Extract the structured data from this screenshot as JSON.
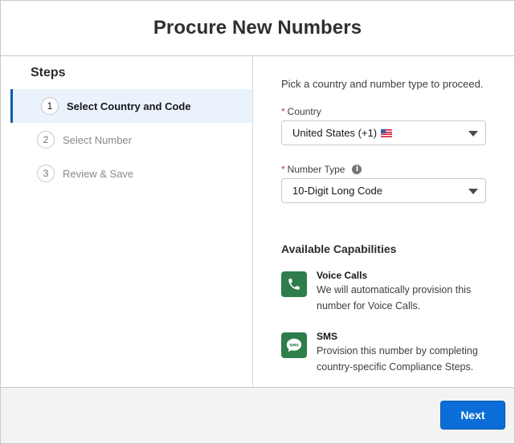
{
  "modal": {
    "title": "Procure New Numbers"
  },
  "steps": {
    "heading": "Steps",
    "items": [
      {
        "number": "1",
        "label": "Select Country and Code",
        "state": "active"
      },
      {
        "number": "2",
        "label": "Select Number",
        "state": "inactive"
      },
      {
        "number": "3",
        "label": "Review & Save",
        "state": "inactive"
      }
    ]
  },
  "form": {
    "intro": "Pick a country and number type to proceed.",
    "country": {
      "required_marker": "*",
      "label": "Country",
      "value": "United States (+1)",
      "flag": "us-flag-emoji"
    },
    "number_type": {
      "required_marker": "*",
      "label": "Number Type",
      "info_icon": "i",
      "value": "10-Digit Long Code"
    }
  },
  "capabilities": {
    "heading": "Available Capabilities",
    "items": [
      {
        "icon": "phone-icon",
        "title": "Voice Calls",
        "description": "We will automatically provision this number for Voice Calls."
      },
      {
        "icon": "sms-icon",
        "title": "SMS",
        "description": "Provision this number by completing country-specific Compliance Steps."
      }
    ],
    "icon_color": "#2e7d4a"
  },
  "footer": {
    "next_label": "Next",
    "accent": "#0b6dd7"
  }
}
